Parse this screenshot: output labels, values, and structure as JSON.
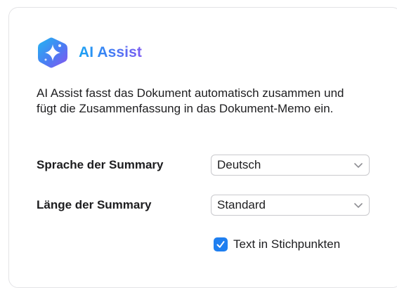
{
  "app": {
    "title": "AI Assist",
    "description": "AI Assist fasst das Dokument automatisch zusammen und fügt die Zusammenfassung in das Dokument-Memo ein."
  },
  "settings": {
    "language": {
      "label": "Sprache der Summary",
      "value": "Deutsch"
    },
    "length": {
      "label": "Länge der Summary",
      "value": "Standard"
    },
    "bullets": {
      "label": "Text in Stichpunkten",
      "checked": true
    }
  },
  "colors": {
    "accent": "#1f7ff0",
    "title_gradient": [
      "#1aa3f3",
      "#7c5cf2"
    ]
  },
  "icons": {
    "logo": "ai-assist-logo-icon",
    "chevron": "chevron-down-icon",
    "checkmark": "checkmark-icon"
  }
}
